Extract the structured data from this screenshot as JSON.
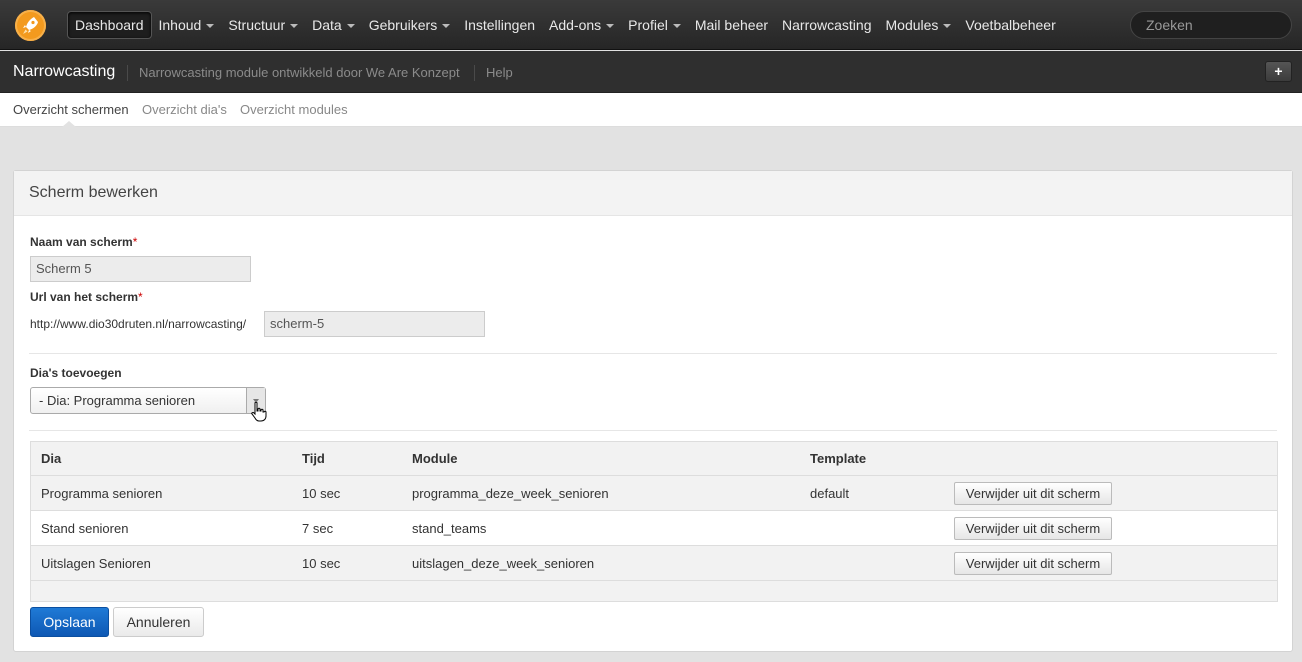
{
  "topnav": {
    "items": [
      {
        "label": "Dashboard",
        "has_caret": false
      },
      {
        "label": "Inhoud",
        "has_caret": true
      },
      {
        "label": "Structuur",
        "has_caret": true
      },
      {
        "label": "Data",
        "has_caret": true
      },
      {
        "label": "Gebruikers",
        "has_caret": true
      },
      {
        "label": "Instellingen",
        "has_caret": false
      },
      {
        "label": "Add-ons",
        "has_caret": true
      },
      {
        "label": "Profiel",
        "has_caret": true
      },
      {
        "label": "Mail beheer",
        "has_caret": false
      },
      {
        "label": "Narrowcasting",
        "has_caret": false
      },
      {
        "label": "Modules",
        "has_caret": true
      },
      {
        "label": "Voetbalbeheer",
        "has_caret": false
      }
    ],
    "search_placeholder": "Zoeken",
    "logo_icon": "rocket-icon",
    "brand_color": "#f39a1e"
  },
  "subbar": {
    "title": "Narrowcasting",
    "description": "Narrowcasting module ontwikkeld door We Are Konzept",
    "help": "Help",
    "add_label": "+"
  },
  "tabs": [
    {
      "label": "Overzicht schermen",
      "active": true
    },
    {
      "label": "Overzicht dia's",
      "active": false
    },
    {
      "label": "Overzicht modules",
      "active": false
    }
  ],
  "form": {
    "title": "Scherm bewerken",
    "name_label": "Naam van scherm",
    "name_value": "Scherm 5",
    "url_label": "Url van het scherm",
    "url_prefix": "http://www.dio30druten.nl/narrowcasting/",
    "url_value": "scherm-5",
    "required_mark": "*",
    "slides_label": "Dia's toevoegen",
    "slides_selected": "- Dia: Programma senioren"
  },
  "table": {
    "headers": [
      "Dia",
      "Tijd",
      "Module",
      "Template"
    ],
    "remove_label": "Verwijder uit dit scherm",
    "rows": [
      {
        "dia": "Programma senioren",
        "tijd": "10 sec",
        "module": "programma_deze_week_senioren",
        "template": "default"
      },
      {
        "dia": "Stand senioren",
        "tijd": "7 sec",
        "module": "stand_teams",
        "template": ""
      },
      {
        "dia": "Uitslagen Senioren",
        "tijd": "10 sec",
        "module": "uitslagen_deze_week_senioren",
        "template": ""
      }
    ]
  },
  "actions": {
    "save": "Opslaan",
    "cancel": "Annuleren",
    "save_color": "#1466c4"
  }
}
